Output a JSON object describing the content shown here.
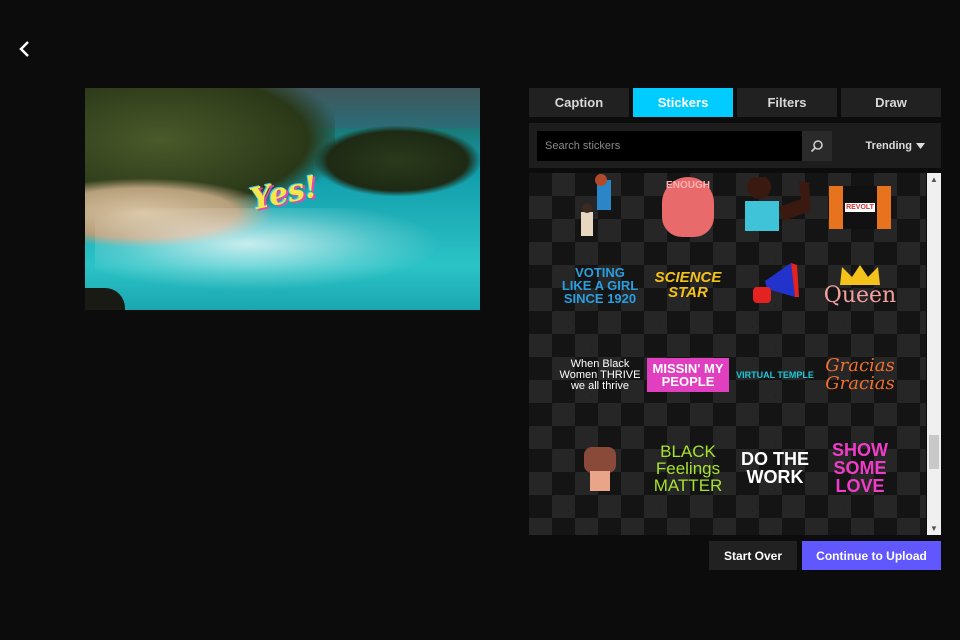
{
  "nav": {
    "back_icon": "chevron-left-icon"
  },
  "preview": {
    "overlay_text": "Yes!"
  },
  "tabs": [
    {
      "label": "Caption"
    },
    {
      "label": "Stickers",
      "active": true
    },
    {
      "label": "Filters"
    },
    {
      "label": "Draw"
    }
  ],
  "search": {
    "placeholder": "Search stickers",
    "value": "",
    "icon": "search-icon"
  },
  "sort": {
    "selected": "Trending",
    "icon": "caret-down-icon"
  },
  "stickers": [
    {
      "label": "",
      "kind": "helping-hand"
    },
    {
      "label": "ENOUGH",
      "kind": "heart-mask"
    },
    {
      "label": "",
      "kind": "flexing-woman"
    },
    {
      "label": "REVOLT",
      "kind": "lobsters"
    },
    {
      "label": "VOTING LIKE A GIRL SINCE 1920"
    },
    {
      "label": "SCIENCE STAR"
    },
    {
      "label": "",
      "kind": "megaphone"
    },
    {
      "label": "Queen"
    },
    {
      "label": "When Black Women THRIVE we all thrive"
    },
    {
      "label": "MISSIN' MY PEOPLE"
    },
    {
      "label": "VIRTUAL TEMPLE"
    },
    {
      "label": "Gracias Gracias"
    },
    {
      "label": "",
      "kind": "raised-fist"
    },
    {
      "label": "BLACK Feelings MATTER"
    },
    {
      "label": "DO THE WORK"
    },
    {
      "label": "SHOW SOME LOVE"
    }
  ],
  "actions": {
    "start_over": "Start Over",
    "continue": "Continue to Upload"
  },
  "colors": {
    "accent": "#00ccff",
    "primary_button": "#6157ff",
    "background": "#0c0c0c"
  }
}
